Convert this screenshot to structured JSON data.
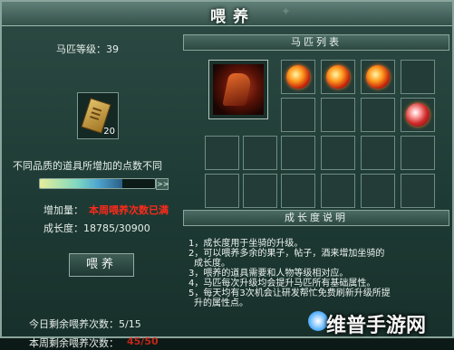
{
  "window": {
    "title": "喂养"
  },
  "left": {
    "level_label": "马匹等级：39",
    "item_count": "20",
    "hint": "不同品质的道具所增加的点数不同",
    "progress_fraction": 0.72,
    "bar_button": ">>",
    "increase_label": "增加量：",
    "increase_value": "本周喂养次数已满",
    "growth_label": "成长度：18785/30900",
    "feed_button": "喂养",
    "daily_remaining": "今日剩余喂养次数：5/15",
    "weekly_label": "本周剩余喂养次数：",
    "weekly_value": "45/50"
  },
  "right": {
    "list_header": "马匹列表",
    "growth_header": "成长度说明",
    "desc_lines": [
      "1，成长度用于坐骑的升级。",
      "2，可以喂养多余的果子，帖子，酒来增加坐骑的",
      "成长度。",
      "3，喂养的道具需要和人物等级相对应。",
      "4，马匹每次升级均会提升马匹所有基础属性。",
      "5，每天均有3次机会让研发帮忙免费刷新升级所提",
      "升的属性点。"
    ]
  },
  "watermark": "维普手游网",
  "colors": {
    "accent": "#ff2a1a",
    "panel": "#1e3a34"
  }
}
